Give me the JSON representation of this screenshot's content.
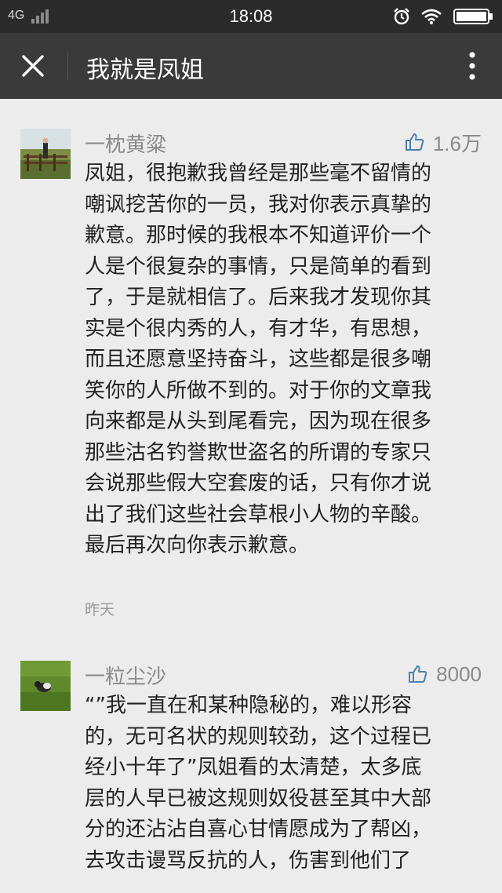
{
  "status_bar": {
    "network": "4G",
    "time": "18:08",
    "icons": [
      "signal-icon",
      "alarm-icon",
      "wifi-icon",
      "battery-icon"
    ]
  },
  "nav": {
    "title": "我就是凤姐",
    "close_icon": "close-icon",
    "more_icon": "more-vertical-icon"
  },
  "comments": [
    {
      "name": "一枕黄粱",
      "likes": "1.6万",
      "lines": [
        "凤姐，很抱歉我曾经是那些毫不留情的",
        "嘲讽挖苦你的一员，我对你表示真挚的",
        "歉意。那时候的我根本不知道评价一个",
        "人是个很复杂的事情，只是简单的看到",
        "了，于是就相信了。后来我才发现你其",
        "实是个很内秀的人，有才华，有思想，",
        "而且还愿意坚持奋斗，这些都是很多嘲",
        "笑你的人所做不到的。对于你的文章我",
        "向来都是从头到尾看完，因为现在很多",
        "那些沽名钓誉欺世盗名的所谓的专家只",
        "会说那些假大空套废的话，只有你才说",
        "出了我们这些社会草根小人物的辛酸。",
        "最后再次向你表示歉意。"
      ],
      "time": "昨天"
    },
    {
      "name": "一粒尘沙",
      "likes": "8000",
      "lines": [
        "“”我一直在和某种隐秘的，难以形容",
        "的，无可名状的规则较劲，这个过程已",
        "经小十年了”凤姐看的太清楚，太多底",
        "层的人早已被这规则奴役甚至其中大部",
        "分的还沾沾自喜心甘情愿成为了帮凶，",
        "去攻击谩骂反抗的人，伤害到他们了"
      ]
    }
  ],
  "colors": {
    "status_bar": "#2b2b2b",
    "nav_bar": "#3a3a3a",
    "background": "#ececec",
    "meta_text": "#8a8a8a",
    "body_text": "#222222"
  }
}
